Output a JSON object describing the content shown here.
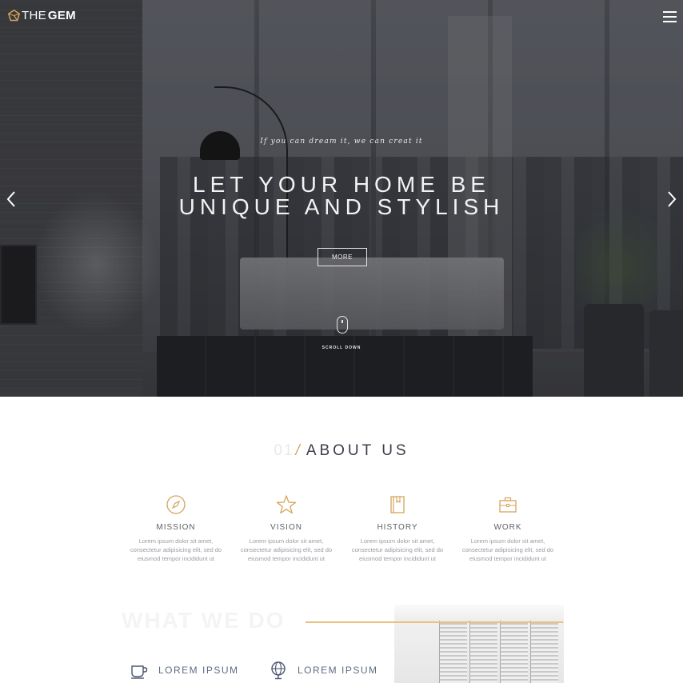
{
  "brand": {
    "prefix": "THE",
    "name": "GEM",
    "accent": "#d6a45a"
  },
  "hero": {
    "tagline": "If you can dream it, we can creat it",
    "headline_line1": "LET YOUR HOME BE",
    "headline_line2": "UNIQUE AND STYLISH",
    "more_label": "MORE",
    "scroll_label": "SCROLL DOWN",
    "icons": {
      "menu": "hamburger-icon",
      "prev": "chevron-left-icon",
      "next": "chevron-right-icon",
      "mouse": "mouse-icon"
    }
  },
  "about": {
    "number": "01",
    "slash": "/",
    "title": "ABOUT US",
    "features": [
      {
        "icon": "compass-icon",
        "title": "MISSION",
        "desc_1": "Lorem ipsum dolor sit amet,",
        "desc_2": "consectetur adipisicing elit, sed do",
        "desc_3": "eiusmod tempor incididunt ut"
      },
      {
        "icon": "star-icon",
        "title": "VISION",
        "desc_1": "Lorem ipsum dolor sit amet,",
        "desc_2": "consectetur adipisicing elit, sed do",
        "desc_3": "eiusmod tempor incididunt ut"
      },
      {
        "icon": "book-icon",
        "title": "HISTORY",
        "desc_1": "Lorem ipsum dolor sit amet,",
        "desc_2": "consectetur adipisicing elit, sed do",
        "desc_3": "eiusmod tempor incididunt ut"
      },
      {
        "icon": "briefcase-icon",
        "title": "WORK",
        "desc_1": "Lorem ipsum dolor sit amet,",
        "desc_2": "consectetur adipisicing elit, sed do",
        "desc_3": "eiusmod tempor incididunt ut"
      }
    ]
  },
  "what_we_do": {
    "title": "WHAT WE DO",
    "services": [
      {
        "icon": "coffee-cup-icon",
        "label": "LOREM IPSUM"
      },
      {
        "icon": "globe-icon",
        "label": "LOREM IPSUM"
      }
    ]
  }
}
